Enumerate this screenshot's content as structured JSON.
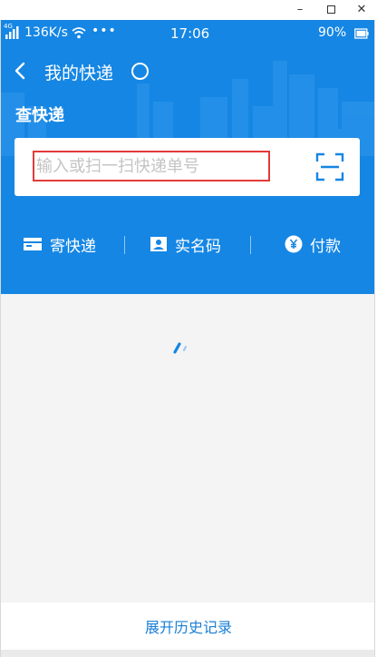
{
  "window": {
    "minimize": "–",
    "close": "✕"
  },
  "status_bar": {
    "network": "4G",
    "speed": "136K/s",
    "dots": "•••",
    "time": "17:06",
    "battery": "90%"
  },
  "nav": {
    "title": "我的快递"
  },
  "query": {
    "section_title": "查快递",
    "placeholder": "输入或扫一扫快递单号",
    "value": ""
  },
  "actions": [
    {
      "label": "寄快递",
      "icon": "package-icon"
    },
    {
      "label": "实名码",
      "icon": "id-card-icon"
    },
    {
      "label": "付款",
      "icon": "yuan-icon"
    }
  ],
  "footer": {
    "link": "展开历史记录"
  },
  "colors": {
    "brand_blue": "#1586e4",
    "link_blue": "#1a7fd6",
    "highlight_red": "#e23a3a",
    "background": "#f4f4f4"
  }
}
